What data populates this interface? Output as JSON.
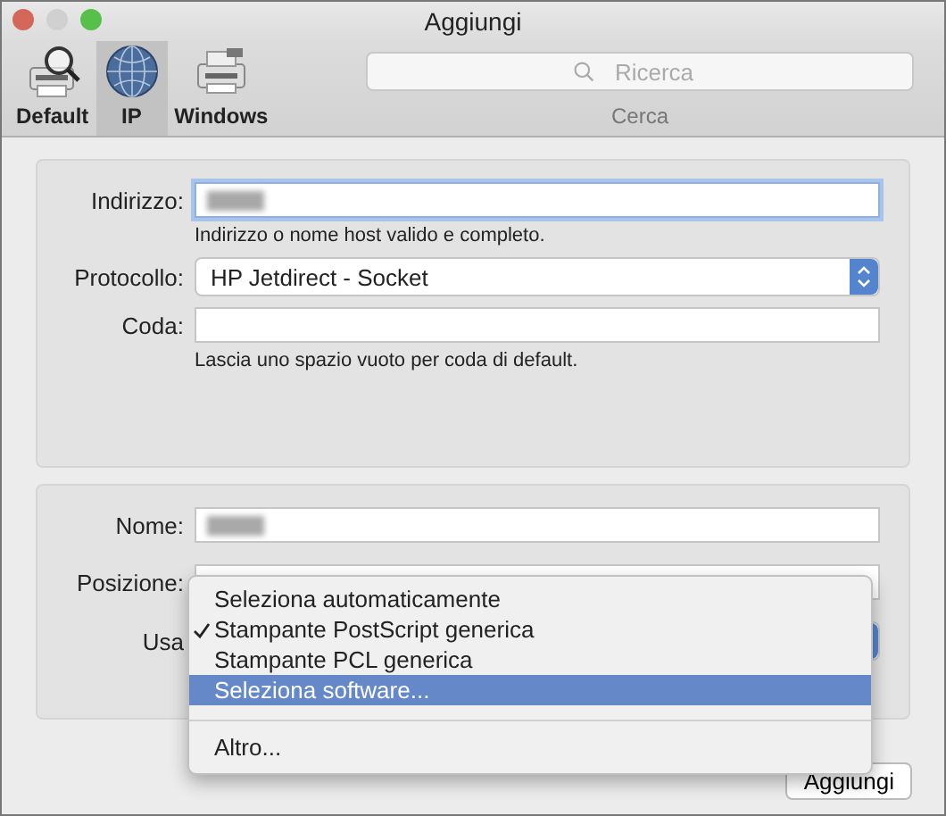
{
  "window": {
    "title": "Aggiungi"
  },
  "toolbar": {
    "items": [
      {
        "label": "Default",
        "kind": "printer-search",
        "selected": false
      },
      {
        "label": "IP",
        "kind": "globe",
        "selected": true
      },
      {
        "label": "Windows",
        "kind": "printer",
        "selected": false
      }
    ],
    "search": {
      "placeholder": "Ricerca",
      "label": "Cerca"
    }
  },
  "connection": {
    "rows": [
      {
        "kind": "text",
        "label": "Indirizzo:",
        "focused": true,
        "blurred": true,
        "hint": "Indirizzo o nome host valido e completo."
      },
      {
        "kind": "popup",
        "label": "Protocollo:",
        "value": "HP Jetdirect - Socket"
      },
      {
        "kind": "text",
        "label": "Coda:",
        "focused": false,
        "hint": "Lascia uno spazio vuoto per coda di default."
      }
    ]
  },
  "printer": {
    "rows": [
      {
        "kind": "text",
        "label": "Nome:",
        "focused": false,
        "blurred": true
      },
      {
        "kind": "text",
        "label": "Posizione:",
        "focused": false
      },
      {
        "kind": "popup",
        "label": "Usa"
      }
    ]
  },
  "menu": {
    "items": [
      {
        "kind": "item",
        "label": "Seleziona automaticamente",
        "checked": false,
        "selected": false
      },
      {
        "kind": "item",
        "label": "Stampante PostScript generica",
        "checked": true,
        "selected": false
      },
      {
        "kind": "item",
        "label": "Stampante PCL generica",
        "checked": false,
        "selected": false
      },
      {
        "kind": "item",
        "label": "Seleziona software...",
        "checked": false,
        "selected": true
      },
      {
        "kind": "separator"
      },
      {
        "kind": "item",
        "label": "Altro...",
        "checked": false,
        "selected": false
      }
    ]
  },
  "buttons": [
    {
      "label": "Aggiungi"
    }
  ]
}
